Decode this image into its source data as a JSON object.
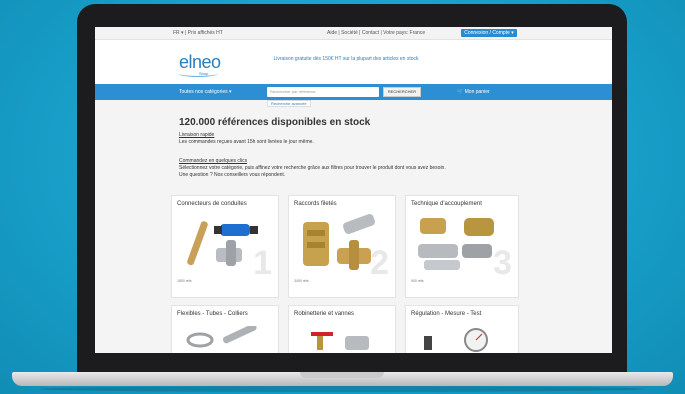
{
  "topbar": {
    "lang": "FR ▾  |  Prix affichés HT",
    "links": "Aide  |  Société  |  Contact  |  Votre pays: France",
    "account": "Connexion / Compte ▾"
  },
  "header": {
    "logo": "elneo",
    "logo_sub": "Shop",
    "promo": "Livraison gratuite dès 150€ HT sur la plupart des articles en stock"
  },
  "nav": {
    "categories": "Toutes nos catégories ▾",
    "search_placeholder": "Rechercher par référence",
    "search_button": "RECHERCHER",
    "cart": "Mon panier",
    "under_search": "Recherche avancée"
  },
  "main": {
    "title": "120.000 références disponibles en stock",
    "line1": "Livraison rapide",
    "line2": "Les commandes reçues avant 15h sont livrées le jour même.",
    "line3": "Commandez en quelques clics",
    "line4": "Sélectionnez votre catégorie, puis affinez votre recherche grâce aux filtres pour trouver le produit dont vous avez besoin.",
    "line5": "Une question ? Nos conseillers vous répondent."
  },
  "cards": [
    {
      "title": "Connecteurs de conduites",
      "count": "1800 réfs",
      "num": "1"
    },
    {
      "title": "Raccords filetés",
      "count": "3400 réfs",
      "num": "2"
    },
    {
      "title": "Technique d'accouplement",
      "count": "900 réfs",
      "num": "3"
    },
    {
      "title": "Flexibles - Tubes - Colliers",
      "count": "",
      "num": ""
    },
    {
      "title": "Robinetterie et vannes",
      "count": "",
      "num": ""
    },
    {
      "title": "Régulation - Mesure - Test",
      "count": "",
      "num": ""
    }
  ]
}
